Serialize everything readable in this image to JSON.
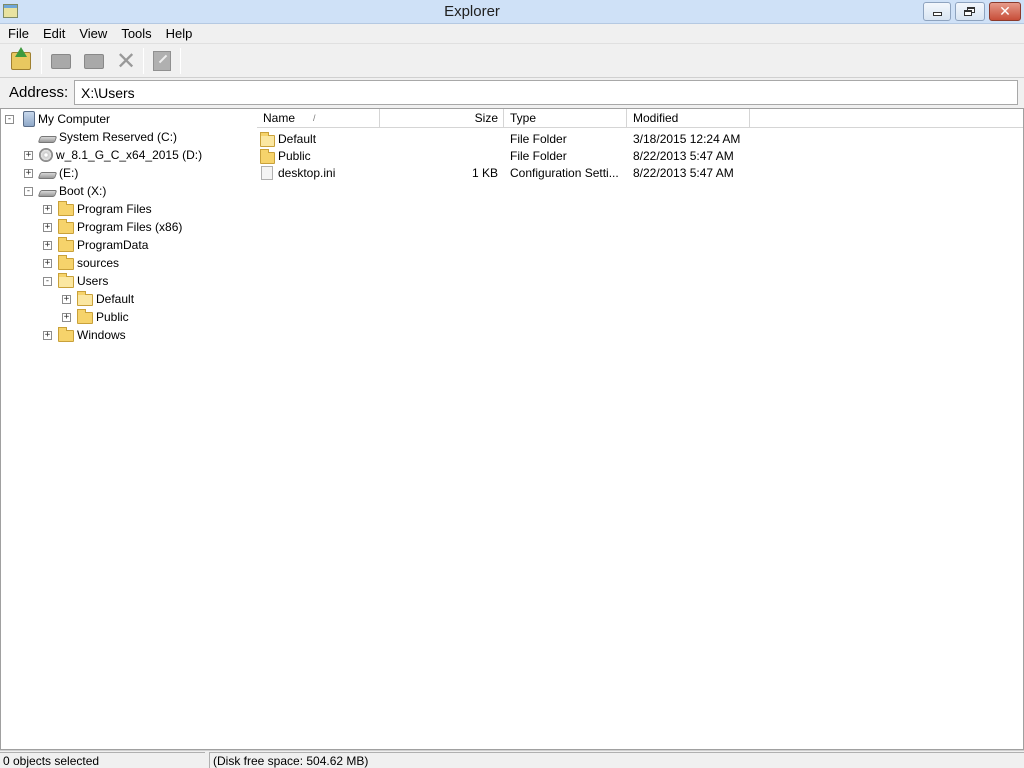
{
  "window": {
    "title": "Explorer"
  },
  "menu": [
    "File",
    "Edit",
    "View",
    "Tools",
    "Help"
  ],
  "toolbar": {
    "buttons": [
      {
        "icon": "up-folder-icon"
      },
      {
        "icon": "copy-folder-icon"
      },
      {
        "icon": "move-folder-icon"
      },
      {
        "icon": "delete-icon"
      },
      {
        "icon": "properties-icon"
      }
    ]
  },
  "address": {
    "label": "Address:",
    "value": "X:\\Users"
  },
  "tree": [
    {
      "label": "My Computer",
      "expander": "-",
      "icon": "computer-icon"
    },
    {
      "label": "System Reserved (C:)",
      "expander": "",
      "icon": "drive-icon"
    },
    {
      "label": "w_8.1_G_C_x64_2015 (D:)",
      "expander": "+",
      "icon": "cd-drive-icon"
    },
    {
      "label": "(E:)",
      "expander": "+",
      "icon": "drive-icon"
    },
    {
      "label": "Boot (X:)",
      "expander": "-",
      "icon": "drive-icon"
    },
    {
      "label": "Program Files",
      "expander": "+",
      "icon": "folder-icon"
    },
    {
      "label": "Program Files (x86)",
      "expander": "+",
      "icon": "folder-icon"
    },
    {
      "label": "ProgramData",
      "expander": "+",
      "icon": "folder-icon"
    },
    {
      "label": "sources",
      "expander": "+",
      "icon": "folder-icon"
    },
    {
      "label": "Users",
      "expander": "-",
      "icon": "folder-open-icon"
    },
    {
      "label": "Default",
      "expander": "+",
      "icon": "folder-icon"
    },
    {
      "label": "Public",
      "expander": "+",
      "icon": "folder-icon"
    },
    {
      "label": "Windows",
      "expander": "+",
      "icon": "folder-icon"
    }
  ],
  "list": {
    "columns": [
      "Name",
      "Size",
      "Type",
      "Modified"
    ],
    "sort_indicator": "/",
    "rows": [
      {
        "name": "Default",
        "size": "",
        "type": "File Folder",
        "modified": "3/18/2015 12:24 AM",
        "icon": "folder-icon"
      },
      {
        "name": "Public",
        "size": "",
        "type": "File Folder",
        "modified": "8/22/2013 5:47 AM",
        "icon": "folder-icon"
      },
      {
        "name": "desktop.ini",
        "size": "1 KB",
        "type": "Configuration Setti...",
        "modified": "8/22/2013 5:47 AM",
        "icon": "config-file-icon"
      }
    ]
  },
  "status": {
    "selected": "0 objects selected",
    "disk_free": "(Disk free space: 504.62 MB)"
  }
}
